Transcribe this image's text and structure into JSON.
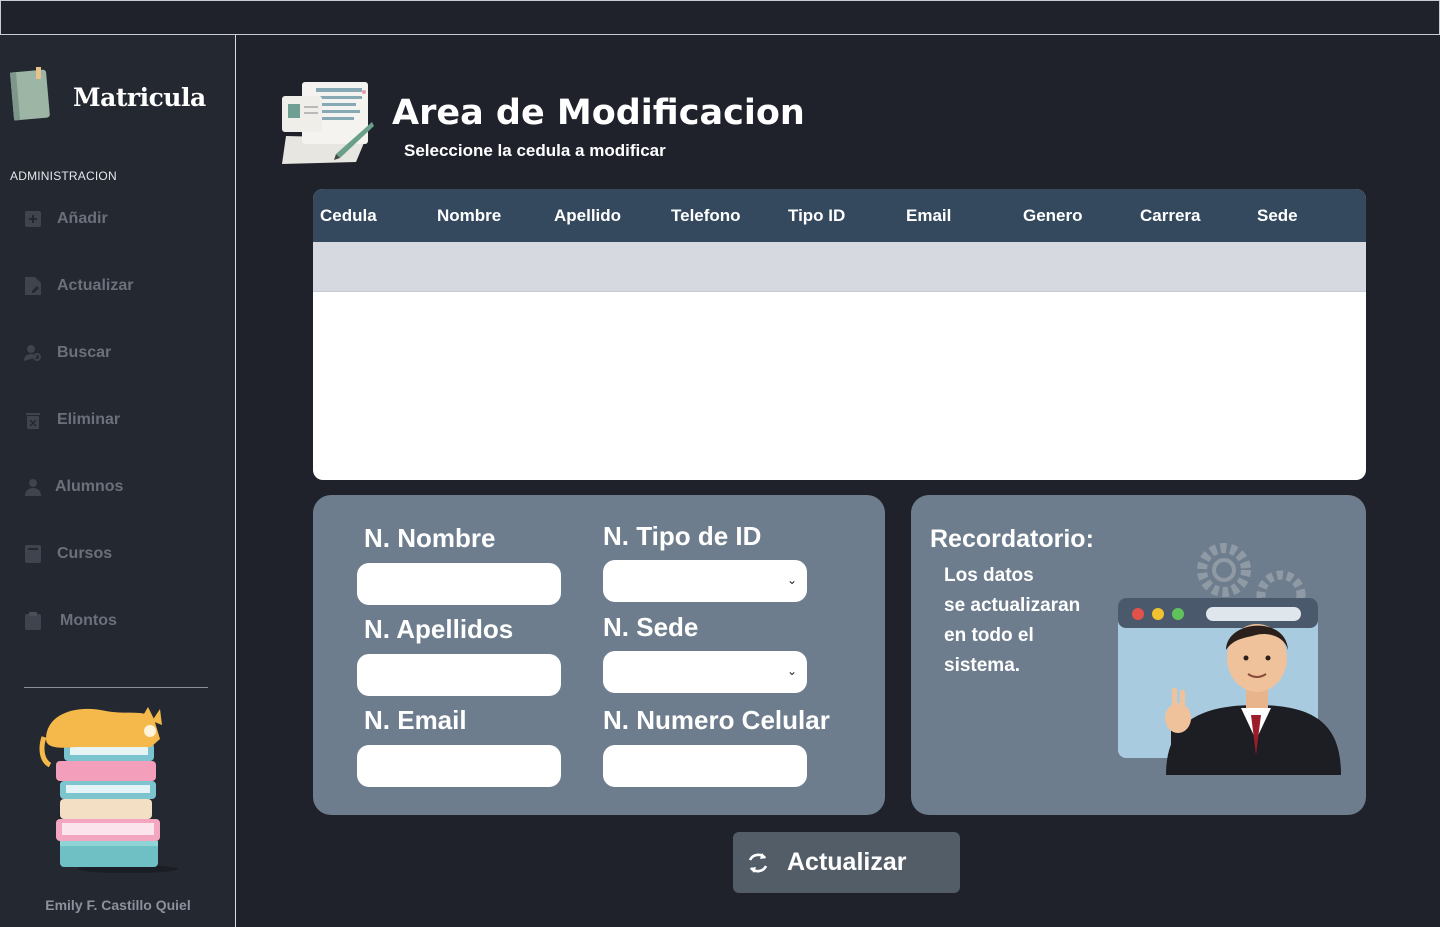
{
  "sidebar": {
    "brand": "Matricula",
    "section_label": "ADMINISTRACION",
    "items": [
      {
        "label": "Añadir",
        "icon": "plus-square-icon"
      },
      {
        "label": "Actualizar",
        "icon": "file-edit-icon"
      },
      {
        "label": "Buscar",
        "icon": "user-search-icon"
      },
      {
        "label": "Eliminar",
        "icon": "trash-icon"
      },
      {
        "label": "Alumnos",
        "icon": "user-icon"
      },
      {
        "label": "Cursos",
        "icon": "book-icon"
      },
      {
        "label": "Montos",
        "icon": "clipboard-icon"
      }
    ],
    "author": "Emily F. Castillo Quiel"
  },
  "header": {
    "title": "Area de Modificacion",
    "subtitle": "Seleccione la cedula a modificar"
  },
  "table": {
    "columns": [
      "Cedula",
      "Nombre",
      "Apellido",
      "Telefono",
      "Tipo ID",
      "Email",
      "Genero",
      "Carrera",
      "Sede"
    ],
    "rows": []
  },
  "form": {
    "nombre_label": "N. Nombre",
    "apellidos_label": "N. Apellidos",
    "email_label": "N. Email",
    "tipo_id_label": "N. Tipo de ID",
    "sede_label": "N. Sede",
    "celular_label": "N. Numero Celular",
    "nombre_value": "",
    "apellidos_value": "",
    "email_value": "",
    "tipo_id_value": "",
    "sede_value": "",
    "celular_value": ""
  },
  "reminder": {
    "title": "Recordatorio:",
    "lines": [
      "Los datos",
      "se actualizaran",
      "en todo el",
      "sistema."
    ]
  },
  "actions": {
    "update_label": "Actualizar"
  },
  "colors": {
    "background": "#1f222b",
    "sidebar": "#242831",
    "table_header": "#34495e",
    "card": "#6e7d8d",
    "button": "#525d68"
  }
}
